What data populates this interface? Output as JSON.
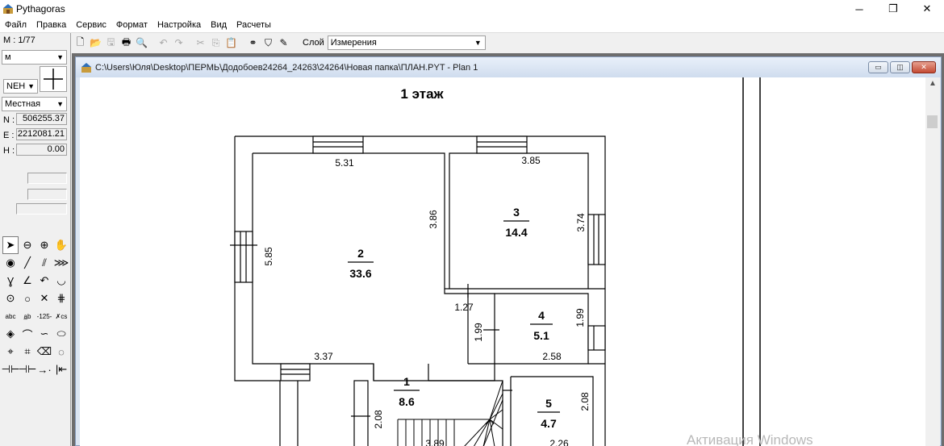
{
  "window": {
    "title": "Pythagoras",
    "controls": {
      "minimize": "─",
      "restore": "❐",
      "close": "✕"
    }
  },
  "menu": [
    "Файл",
    "Правка",
    "Сервис",
    "Формат",
    "Настройка",
    "Вид",
    "Расчеты"
  ],
  "left_panel": {
    "scale": "М : 1/77",
    "unit": "м",
    "coord_order": "NEH",
    "coord_system": "Местная",
    "coords": [
      {
        "label": "N :",
        "value": "506255.37"
      },
      {
        "label": "E :",
        "value": "2212081.21"
      },
      {
        "label": "H :",
        "value": "0.00"
      }
    ],
    "tools": [
      {
        "icon": "select-arrow-icon",
        "glyph": "➤"
      },
      {
        "icon": "zoom-out-icon",
        "glyph": "⊖"
      },
      {
        "icon": "zoom-in-icon",
        "glyph": "⊕"
      },
      {
        "icon": "pan-hand-icon",
        "glyph": "✋"
      },
      {
        "icon": "point-icon",
        "glyph": "◉"
      },
      {
        "icon": "line-icon",
        "glyph": "╱"
      },
      {
        "icon": "parallel-lines-icon",
        "glyph": "⫽"
      },
      {
        "icon": "multi-line-icon",
        "glyph": "⋙"
      },
      {
        "icon": "perpendicular-icon",
        "glyph": "Ɣ"
      },
      {
        "icon": "angle-icon",
        "glyph": "∠"
      },
      {
        "icon": "arc-icon",
        "glyph": "↶"
      },
      {
        "icon": "arc-center-icon",
        "glyph": "◡"
      },
      {
        "icon": "circle-center-icon",
        "glyph": "⊙"
      },
      {
        "icon": "circle-icon",
        "glyph": "○"
      },
      {
        "icon": "intersection-icon",
        "glyph": "✕"
      },
      {
        "icon": "hatch-icon",
        "glyph": "⋕"
      },
      {
        "icon": "text-icon",
        "glyph": "abc"
      },
      {
        "icon": "text-vertical-icon",
        "glyph": "a̲b"
      },
      {
        "icon": "dimension-icon",
        "glyph": "-125-"
      },
      {
        "icon": "coordinate-icon",
        "glyph": "✗cs"
      },
      {
        "icon": "symbol-icon",
        "glyph": "◈"
      },
      {
        "icon": "curve-icon",
        "glyph": "⌒"
      },
      {
        "icon": "spline-icon",
        "glyph": "∽"
      },
      {
        "icon": "ellipse-icon",
        "glyph": "⬭"
      },
      {
        "icon": "measure-area-icon",
        "glyph": "⌖"
      },
      {
        "icon": "parcel-icon",
        "glyph": "⌗"
      },
      {
        "icon": "eraser-icon",
        "glyph": "⌫"
      },
      {
        "icon": "lasso-icon",
        "glyph": "◌"
      },
      {
        "icon": "dimension-chain-icon",
        "glyph": "⊣⊢"
      },
      {
        "icon": "dimension-chain-2-icon",
        "glyph": "⊣⊢"
      },
      {
        "icon": "dimension-arrow-icon",
        "glyph": "→·"
      },
      {
        "icon": "dimension-start-icon",
        "glyph": "|⇤"
      }
    ]
  },
  "toolbar": {
    "buttons": [
      {
        "icon": "new-file-icon",
        "glyph": "🗋",
        "enabled": true
      },
      {
        "icon": "open-folder-icon",
        "glyph": "📂",
        "enabled": true
      },
      {
        "icon": "save-icon",
        "glyph": "🖫",
        "enabled": false
      },
      {
        "icon": "print-icon",
        "glyph": "🖶",
        "enabled": true
      },
      {
        "icon": "print-preview-icon",
        "glyph": "🔍",
        "enabled": true
      },
      {
        "icon": "undo-icon",
        "glyph": "↶",
        "enabled": false
      },
      {
        "icon": "redo-icon",
        "glyph": "↷",
        "enabled": false
      },
      {
        "icon": "cut-icon",
        "glyph": "✂",
        "enabled": false
      },
      {
        "icon": "copy-icon",
        "glyph": "⎘",
        "enabled": false
      },
      {
        "icon": "paste-icon",
        "glyph": "📋",
        "enabled": true
      },
      {
        "icon": "find-binoculars-icon",
        "glyph": "⚭",
        "enabled": true
      },
      {
        "icon": "layer-icon",
        "glyph": "⛉",
        "enabled": true
      },
      {
        "icon": "style-icon",
        "glyph": "✎",
        "enabled": true
      }
    ],
    "layer_label": "Слой",
    "layer_value": "Измерения"
  },
  "document": {
    "title": "C:\\Users\\Юля\\Desktop\\ПЕРМЬ\\Додобоев24264_24263\\24264\\Новая папка\\ПЛАН.PYT - Plan 1",
    "controls": {
      "minimize": "▭",
      "restore": "◫",
      "close": "✕"
    }
  },
  "plan": {
    "title": "1 этаж",
    "rooms": [
      {
        "number": "1",
        "area": "8.6"
      },
      {
        "number": "2",
        "area": "33.6"
      },
      {
        "number": "3",
        "area": "14.4"
      },
      {
        "number": "4",
        "area": "5.1"
      },
      {
        "number": "5",
        "area": "4.7"
      }
    ],
    "dimensions": {
      "d_5_31": "5.31",
      "d_3_85": "3.85",
      "d_3_86": "3.86",
      "d_3_74": "3.74",
      "d_5_85": "5.85",
      "d_1_27": "1.27",
      "d_1_99a": "1.99",
      "d_1_99b": "1.99",
      "d_2_58": "2.58",
      "d_3_37": "3.37",
      "d_2_08a": "2.08",
      "d_2_08b": "2.08",
      "d_3_89": "3.89",
      "d_2_26": "2.26"
    }
  },
  "watermark": "Активация Windows"
}
